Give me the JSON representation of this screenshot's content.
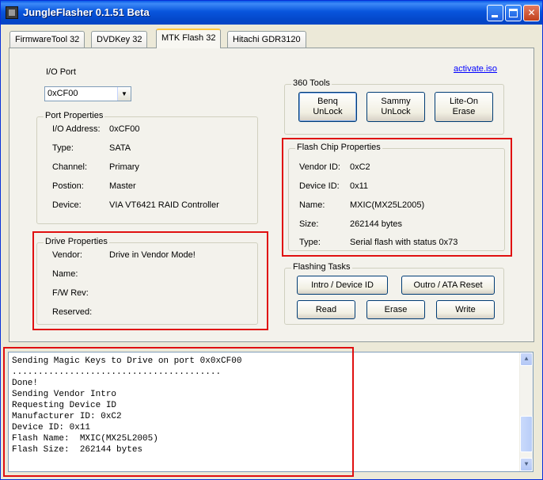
{
  "window": {
    "title": "JungleFlasher 0.1.51 Beta",
    "minimize_label": "–",
    "close_label": "✕"
  },
  "tabs": [
    {
      "label": "FirmwareTool 32"
    },
    {
      "label": "DVDKey 32"
    },
    {
      "label": "MTK Flash 32"
    },
    {
      "label": "Hitachi GDR3120"
    }
  ],
  "io_port": {
    "label": "I/O Port",
    "value": "0xCF00",
    "arrow": "▼"
  },
  "activate_link": "activate.iso",
  "port_properties": {
    "title": "Port Properties",
    "rows": [
      {
        "label": "I/O Address:",
        "value": "0xCF00"
      },
      {
        "label": "Type:",
        "value": "SATA"
      },
      {
        "label": "Channel:",
        "value": "Primary"
      },
      {
        "label": "Postion:",
        "value": "Master"
      },
      {
        "label": "Device:",
        "value": "VIA VT6421 RAID Controller"
      }
    ]
  },
  "drive_properties": {
    "title": "Drive Properties",
    "rows": [
      {
        "label": "Vendor:",
        "value": "Drive in Vendor Mode!"
      },
      {
        "label": "Name:",
        "value": ""
      },
      {
        "label": "F/W Rev:",
        "value": ""
      },
      {
        "label": "Reserved:",
        "value": ""
      }
    ]
  },
  "tools_360": {
    "title": "360 Tools",
    "buttons": [
      {
        "line1": "Benq",
        "line2": "UnLock"
      },
      {
        "line1": "Sammy",
        "line2": "UnLock"
      },
      {
        "line1": "Lite-On",
        "line2": "Erase"
      }
    ]
  },
  "flash_chip": {
    "title": "Flash Chip Properties",
    "rows": [
      {
        "label": "Vendor ID:",
        "value": "0xC2"
      },
      {
        "label": "Device ID:",
        "value": "0x11"
      },
      {
        "label": "Name:",
        "value": "MXIC(MX25L2005)"
      },
      {
        "label": "Size:",
        "value": "262144 bytes"
      },
      {
        "label": "Type:",
        "value": "Serial flash with status 0x73"
      }
    ]
  },
  "flashing_tasks": {
    "title": "Flashing Tasks",
    "intro": "Intro / Device ID",
    "outro": "Outro / ATA Reset",
    "read": "Read",
    "erase": "Erase",
    "write": "Write"
  },
  "log": {
    "lines": [
      "Sending Magic Keys to Drive on port 0x0xCF00",
      "........................................",
      "Done!",
      "Sending Vendor Intro",
      "Requesting Device ID",
      "Manufacturer ID: 0xC2",
      "Device ID: 0x11",
      "Flash Name:  MXIC(MX25L2005)",
      "Flash Size:  262144 bytes"
    ],
    "scroll_up": "▲",
    "scroll_down": "▼"
  },
  "colors": {
    "titlebar": "#0855DD",
    "highlight_box": "#E01010",
    "link": "#0000FF"
  }
}
